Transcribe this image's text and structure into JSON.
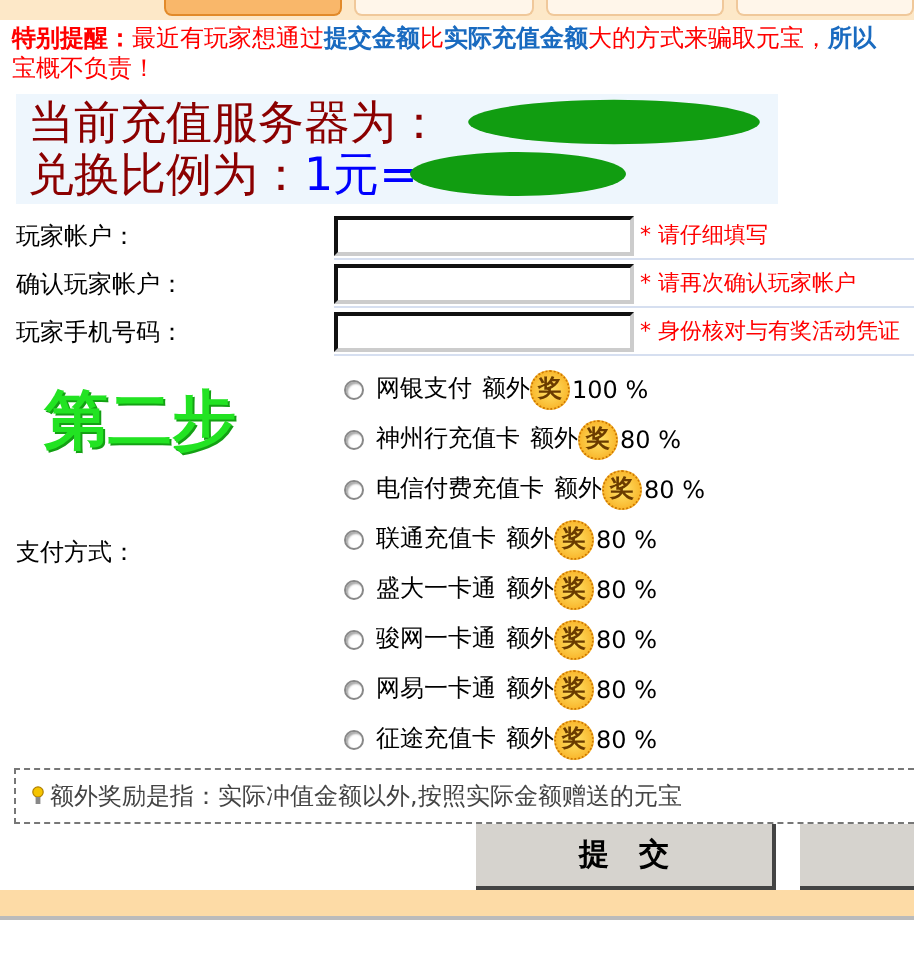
{
  "tabs": [
    {
      "selected": true
    },
    {
      "selected": false
    },
    {
      "selected": false
    },
    {
      "selected": false
    }
  ],
  "notice": {
    "line_1": [
      {
        "text": "特别提醒：",
        "kind": "alert"
      },
      {
        "text": "最近有玩家想通过",
        "kind": "plain"
      },
      {
        "text": "提交金额",
        "kind": "key"
      },
      {
        "text": "比",
        "kind": "plain"
      },
      {
        "text": "实际充值金额",
        "kind": "key"
      },
      {
        "text": "大的方式来骗取元宝，",
        "kind": "plain"
      },
      {
        "text": "所以",
        "kind": "key"
      }
    ],
    "line_2": "宝概不负责！"
  },
  "server": {
    "label": "当前充值服务器为：",
    "ratio_label": "兑换比例为：",
    "ratio_value": "1元="
  },
  "fields": [
    {
      "label": "玩家帐户：",
      "hint": "* 请仔细填写"
    },
    {
      "label": "确认玩家帐户：",
      "hint": "* 请再次确认玩家帐户"
    },
    {
      "label": "玩家手机号码：",
      "hint": "* 身份核对与有奖活动凭证"
    }
  ],
  "step": "第二步",
  "payment": {
    "label": "支付方式：",
    "options": [
      {
        "name": "网银支付",
        "extra": "额外",
        "badge": "奖",
        "rate": "100 %",
        "selected": false
      },
      {
        "name": "神州行充值卡",
        "extra": "额外",
        "badge": "奖",
        "rate": "80 %",
        "selected": false
      },
      {
        "name": "电信付费充值卡",
        "extra": "额外",
        "badge": "奖",
        "rate": "80 %",
        "selected": false
      },
      {
        "name": "联通充值卡",
        "extra": "额外",
        "badge": "奖",
        "rate": "80 %",
        "selected": false
      },
      {
        "name": "盛大一卡通",
        "extra": "额外",
        "badge": "奖",
        "rate": "80 %",
        "selected": false
      },
      {
        "name": "骏网一卡通",
        "extra": "额外",
        "badge": "奖",
        "rate": "80 %",
        "selected": false
      },
      {
        "name": "网易一卡通",
        "extra": "额外",
        "badge": "奖",
        "rate": "80 %",
        "selected": false
      },
      {
        "name": "征途充值卡",
        "extra": "额外",
        "badge": "奖",
        "rate": "80 %",
        "selected": false
      }
    ]
  },
  "note": "额外奖励是指：实际冲值金额以外,按照实际金额赠送的元宝",
  "buttons": [
    "提　交"
  ]
}
